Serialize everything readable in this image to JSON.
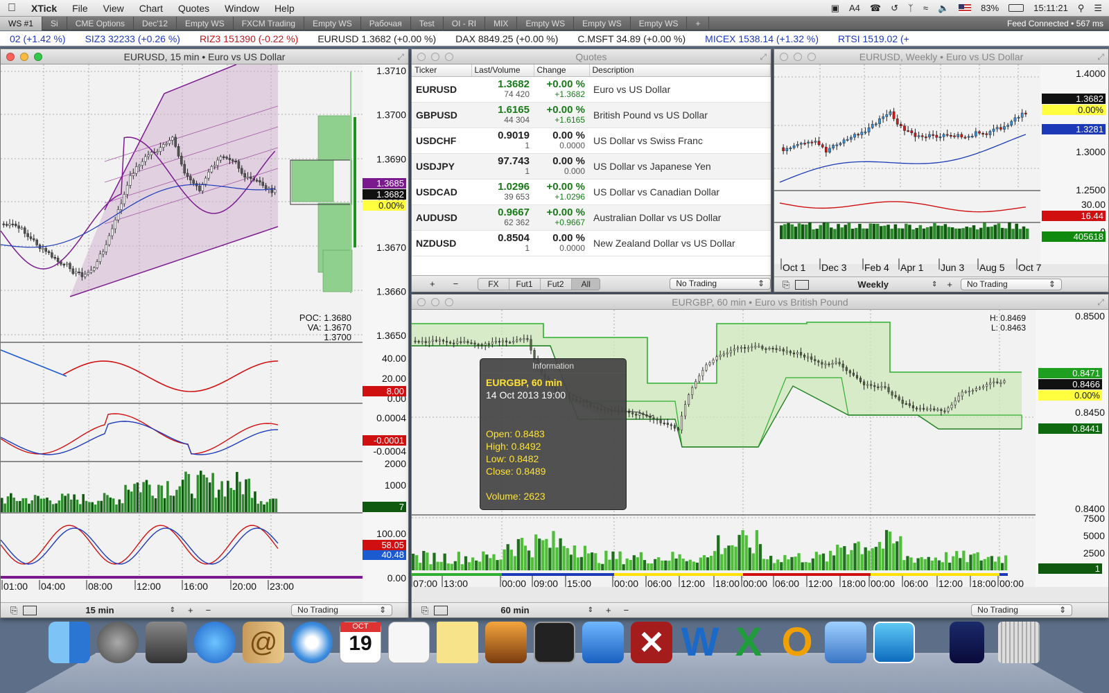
{
  "menubar": {
    "app": "XTick",
    "items": [
      "File",
      "View",
      "Chart",
      "Quotes",
      "Window",
      "Help"
    ],
    "status_badge": "4",
    "battery": "83%",
    "clock": "15:11:21"
  },
  "workspaces": {
    "tabs": [
      "WS #1",
      "Si",
      "CME Options",
      "Dec'12",
      "Empty WS",
      "FXCM Trading",
      "Empty WS",
      "Рабочая",
      "Test",
      "OI - RI",
      "MIX",
      "Empty WS",
      "Empty WS",
      "Empty WS",
      "+"
    ],
    "feed_status": "Feed Connected • 567 ms"
  },
  "ticker": [
    {
      "text": "02 (+1.42 %)",
      "cls": "bl"
    },
    {
      "text": "SIZ3  32233 (+0.26 %)",
      "cls": "bl"
    },
    {
      "text": "RIZ3  151390 (-0.22 %)",
      "cls": "dn"
    },
    {
      "text": "EURUSD  1.3682 (+0.00 %)",
      "cls": ""
    },
    {
      "text": "DAX  8849.25 (+0.00 %)",
      "cls": ""
    },
    {
      "text": "C.MSFT  34.89 (+0.00 %)",
      "cls": ""
    },
    {
      "text": "MICEX  1538.14 (+1.32 %)",
      "cls": "bl"
    },
    {
      "text": "RTSI  1519.02 (+",
      "cls": "bl"
    }
  ],
  "win_eurusd15": {
    "title": "EURUSD, 15 min • Euro vs US Dollar",
    "price_axis": [
      "1.3710",
      "1.3700",
      "1.3690",
      "1.3680",
      "1.3670",
      "1.3660",
      "1.3650"
    ],
    "tags": {
      "purple": "1.3685",
      "black": "1.3682",
      "yellow": "0.00%"
    },
    "poc": [
      "POC: 1.3680",
      "VA: 1.3670",
      "1.3700"
    ],
    "osc1_axis": [
      "40.00",
      "20.00",
      "0.00"
    ],
    "osc1_tag": "8.00",
    "osc2_axis": [
      "0.0004",
      "-0.0004"
    ],
    "osc2_tag": "-0.0001",
    "vol_axis": [
      "2000",
      "1000"
    ],
    "vol_tag": "7",
    "sto_axis": [
      "100.00",
      "0.00"
    ],
    "sto_tag": "58.05",
    "sto_tag2": "40.48",
    "time_axis": [
      "01:00",
      "04:00",
      "08:00",
      "12:00",
      "16:00",
      "20:00",
      "23:00"
    ],
    "footer": {
      "timeframe": "15 min",
      "trading": "No Trading"
    }
  },
  "quotes": {
    "title": "Quotes",
    "columns": [
      "Ticker",
      "Last/Volume",
      "Change",
      "Description"
    ],
    "rows": [
      {
        "ticker": "EURUSD",
        "last": "1.3682",
        "vol": "74 420",
        "chg": "+0.00 %",
        "chg2": "+1.3682",
        "desc": "Euro vs US Dollar",
        "up": true
      },
      {
        "ticker": "GBPUSD",
        "last": "1.6165",
        "vol": "44 304",
        "chg": "+0.00 %",
        "chg2": "+1.6165",
        "desc": "British Pound vs US Dollar",
        "up": true
      },
      {
        "ticker": "USDCHF",
        "last": "0.9019",
        "vol": "1",
        "chg": "0.00 %",
        "chg2": "0.0000",
        "desc": "US Dollar vs Swiss Franc",
        "up": false
      },
      {
        "ticker": "USDJPY",
        "last": "97.743",
        "vol": "1",
        "chg": "0.00 %",
        "chg2": "0.000",
        "desc": "US Dollar vs Japanese Yen",
        "up": false
      },
      {
        "ticker": "USDCAD",
        "last": "1.0296",
        "vol": "39 653",
        "chg": "+0.00 %",
        "chg2": "+1.0296",
        "desc": "US Dollar vs Canadian Dollar",
        "up": true
      },
      {
        "ticker": "AUDUSD",
        "last": "0.9667",
        "vol": "62 362",
        "chg": "+0.00 %",
        "chg2": "+0.9667",
        "desc": "Australian Dollar vs US Dollar",
        "up": true
      },
      {
        "ticker": "NZDUSD",
        "last": "0.8504",
        "vol": "1",
        "chg": "0.00 %",
        "chg2": "0.0000",
        "desc": "New Zealand Dollar vs US Dollar",
        "up": false
      }
    ],
    "filters": [
      "FX",
      "Fut1",
      "Fut2",
      "All"
    ],
    "trading": "No Trading"
  },
  "win_weekly": {
    "title": "EURUSD, Weekly • Euro vs US Dollar",
    "price_axis": [
      "1.4000",
      "1.3000",
      "1.2500"
    ],
    "tags": {
      "black": "1.3682",
      "yellow": "0.00%",
      "blue": "1.3281"
    },
    "osc_axis": [
      "30.00",
      "0"
    ],
    "osc_tag": "16.44",
    "vol_tag": "405618",
    "time_axis": [
      "Oct 1",
      "Dec 3",
      "Feb 4",
      "Apr 1",
      "Jun 3",
      "Aug 5",
      "Oct 7"
    ],
    "footer": {
      "timeframe": "Weekly",
      "trading": "No Trading"
    }
  },
  "win_eurgbp": {
    "title": "EURGBP, 60 min • Euro vs British Pound",
    "hl": [
      "H: 0.8469",
      "L: 0.8463"
    ],
    "price_axis": [
      "0.8500",
      "0.8450",
      "0.8400"
    ],
    "tags": {
      "green": "0.8471",
      "black": "0.8466",
      "yellow": "0.00%",
      "green2": "0.8441"
    },
    "vol_axis": [
      "7500",
      "5000",
      "2500"
    ],
    "vol_tag": "1",
    "time_axis": [
      "07:00",
      "13:00",
      "00:00",
      "09:00",
      "15:00",
      "00:00",
      "06:00",
      "12:00",
      "18:00",
      "00:00",
      "06:00",
      "12:00",
      "18:00",
      "00:00",
      "06:00",
      "12:00",
      "18:00",
      "00:00"
    ],
    "info": {
      "header": "Information",
      "symbol": "EURGBP, 60 min",
      "date": "14 Oct 2013 19:00",
      "open": "Open: 0.8483",
      "high": "High: 0.8492",
      "low": "Low: 0.8482",
      "close": "Close: 0.8489",
      "volume": "Volume: 2623"
    },
    "footer": {
      "timeframe": "60 min",
      "trading": "No Trading"
    }
  },
  "dock": {
    "calendar_month": "OCT",
    "calendar_day": "19"
  },
  "colors": {
    "up": "#1a7a1a",
    "down": "#c01818",
    "accent_purple": "#7b1a8f",
    "green_band": "#2fae2f"
  }
}
